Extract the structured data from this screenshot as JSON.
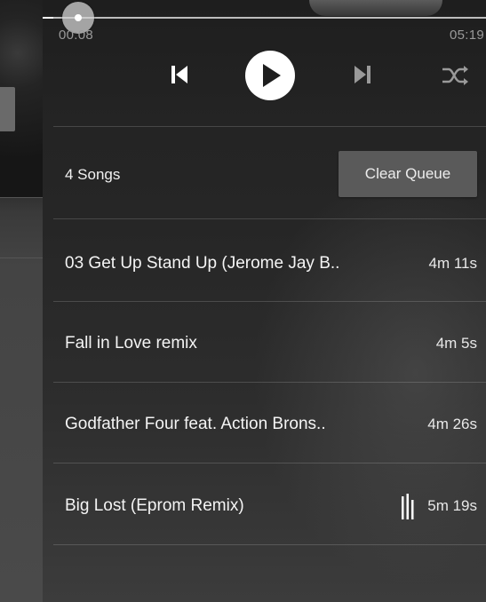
{
  "player": {
    "elapsed": "00:08",
    "total": "05:19",
    "progress_fraction": 0.025,
    "controls": [
      {
        "name": "previous-button",
        "icon": "skip-previous-icon"
      },
      {
        "name": "play-button",
        "icon": "play-icon"
      },
      {
        "name": "next-button",
        "icon": "skip-next-icon"
      },
      {
        "name": "shuffle-button",
        "icon": "shuffle-icon"
      }
    ]
  },
  "queue": {
    "count_label": "4 Songs",
    "clear_label": "Clear Queue",
    "tracks": [
      {
        "title": "03 Get Up Stand Up (Jerome Jay B..",
        "duration": "4m 11s",
        "playing": false
      },
      {
        "title": "Fall in Love remix",
        "duration": "4m 5s",
        "playing": false
      },
      {
        "title": "Godfather Four feat. Action Brons..",
        "duration": "4m 26s",
        "playing": false
      },
      {
        "title": "Big Lost (Eprom Remix)",
        "duration": "5m 19s",
        "playing": true
      }
    ]
  },
  "colors": {
    "background": "#262626",
    "button": "#5a5a5a",
    "text": "#f4f4f4",
    "muted_text": "#9a9a9a",
    "play_button": "#ffffff"
  }
}
